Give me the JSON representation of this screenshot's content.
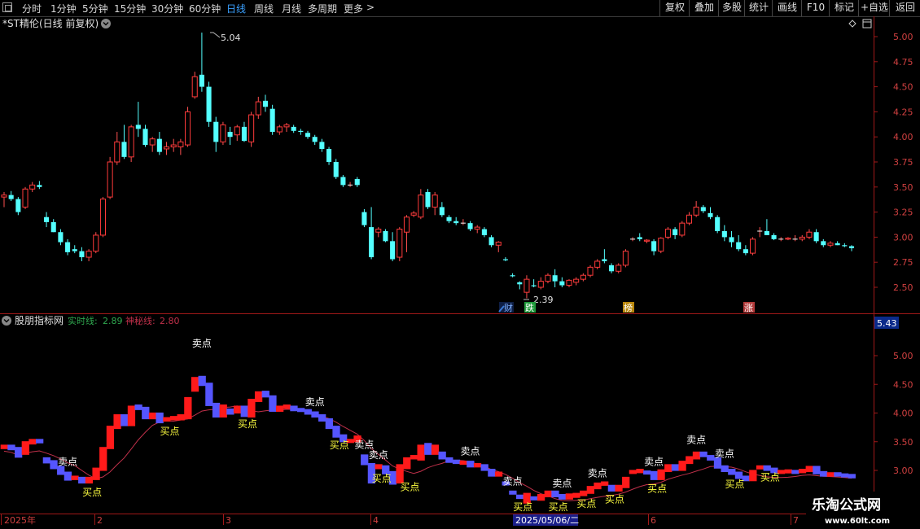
{
  "toolbar": {
    "timeframes": [
      "分时",
      "1分钟",
      "5分钟",
      "15分钟",
      "30分钟",
      "60分钟",
      "日线",
      "周线",
      "月线",
      "多周期",
      "更多"
    ],
    "active": "日线",
    "more_arrow": ">",
    "right_buttons": [
      "复权",
      "叠加",
      "多股",
      "统计",
      "画线",
      "F10",
      "标记",
      "+自选",
      "返回"
    ]
  },
  "main_panel": {
    "title": "*ST精伦(日线 前复权)",
    "y_ticks": [
      "5.00",
      "4.75",
      "4.50",
      "4.25",
      "4.00",
      "3.75",
      "3.50",
      "3.25",
      "3.00",
      "2.75",
      "2.50"
    ],
    "max_label": "5.04",
    "min_label": "2.39",
    "badges": [
      {
        "text": "财",
        "color": "#3b7bd8"
      },
      {
        "text": "跌",
        "color": "#1f9a3a"
      },
      {
        "text": "榜",
        "color": "#b8860b"
      },
      {
        "text": "涨",
        "color": "#b23a3a"
      }
    ]
  },
  "indicator_panel": {
    "name": "股朋指标网",
    "line1_label": "实时线:",
    "line1_value": "2.89",
    "line2_label": "神秘线:",
    "line2_value": "2.80",
    "top_value": "5.43",
    "y_ticks": [
      "5.00",
      "4.50",
      "4.00",
      "3.50",
      "3.00"
    ],
    "sell_label": "卖点",
    "buy_label": "买点"
  },
  "time_axis": {
    "labels": [
      "2025年",
      "2",
      "3",
      "4",
      "5",
      "6",
      "7"
    ],
    "cursor_date": "2025/05/06/二"
  },
  "watermark": {
    "title": "乐淘公式网",
    "url": "www.60lt.com"
  },
  "chart_data": {
    "type": "candlestick",
    "title": "*ST精伦(日线 前复权)",
    "ylim": [
      2.35,
      5.1
    ],
    "colors": {
      "up": "#ff3a3a",
      "down": "#54ffff"
    },
    "candles": [
      [
        3.4,
        3.45,
        3.3,
        3.42
      ],
      [
        3.42,
        3.46,
        3.36,
        3.38
      ],
      [
        3.38,
        3.4,
        3.22,
        3.25
      ],
      [
        3.3,
        3.5,
        3.28,
        3.48
      ],
      [
        3.48,
        3.55,
        3.45,
        3.52
      ],
      [
        3.52,
        3.56,
        3.48,
        3.5
      ],
      [
        3.2,
        3.25,
        3.1,
        3.15
      ],
      [
        3.15,
        3.18,
        3.05,
        3.05
      ],
      [
        3.05,
        3.08,
        2.92,
        2.95
      ],
      [
        2.95,
        2.98,
        2.82,
        2.85
      ],
      [
        2.88,
        2.92,
        2.84,
        2.86
      ],
      [
        2.86,
        2.9,
        2.76,
        2.8
      ],
      [
        2.8,
        2.88,
        2.76,
        2.86
      ],
      [
        2.86,
        3.05,
        2.84,
        3.02
      ],
      [
        3.02,
        3.4,
        3.0,
        3.38
      ],
      [
        3.4,
        3.8,
        3.38,
        3.75
      ],
      [
        3.75,
        4.05,
        3.72,
        3.95
      ],
      [
        3.95,
        4.12,
        3.78,
        3.8
      ],
      [
        3.8,
        4.12,
        3.75,
        4.1
      ],
      [
        4.12,
        4.35,
        4.0,
        4.08
      ],
      [
        4.08,
        4.12,
        3.9,
        3.92
      ],
      [
        3.92,
        4.0,
        3.85,
        3.98
      ],
      [
        3.98,
        4.05,
        3.82,
        3.85
      ],
      [
        3.88,
        3.95,
        3.82,
        3.9
      ],
      [
        3.9,
        3.98,
        3.85,
        3.92
      ],
      [
        3.9,
        3.98,
        3.82,
        3.95
      ],
      [
        3.92,
        4.3,
        3.9,
        4.25
      ],
      [
        4.4,
        4.65,
        4.38,
        4.6
      ],
      [
        4.62,
        5.04,
        4.45,
        4.5
      ],
      [
        4.5,
        4.55,
        4.1,
        4.15
      ],
      [
        4.15,
        4.2,
        3.85,
        3.95
      ],
      [
        3.95,
        4.15,
        3.92,
        4.12
      ],
      [
        4.05,
        4.1,
        3.92,
        4.0
      ],
      [
        4.02,
        4.12,
        3.96,
        4.1
      ],
      [
        4.1,
        4.15,
        3.95,
        3.96
      ],
      [
        3.95,
        4.25,
        3.9,
        4.22
      ],
      [
        4.22,
        4.4,
        4.18,
        4.35
      ],
      [
        4.36,
        4.42,
        4.25,
        4.3
      ],
      [
        4.28,
        4.32,
        4.02,
        4.05
      ],
      [
        4.05,
        4.12,
        4.02,
        4.1
      ],
      [
        4.1,
        4.14,
        4.05,
        4.12
      ],
      [
        4.1,
        4.12,
        4.04,
        4.06
      ],
      [
        4.06,
        4.08,
        4.02,
        4.05
      ],
      [
        4.04,
        4.06,
        3.98,
        4.0
      ],
      [
        4.0,
        4.02,
        3.92,
        3.95
      ],
      [
        3.95,
        3.98,
        3.85,
        3.88
      ],
      [
        3.88,
        3.9,
        3.72,
        3.75
      ],
      [
        3.75,
        3.78,
        3.58,
        3.6
      ],
      [
        3.6,
        3.62,
        3.5,
        3.52
      ],
      [
        3.52,
        3.55,
        3.5,
        3.52
      ],
      [
        3.58,
        3.6,
        3.5,
        3.52
      ],
      [
        3.25,
        3.28,
        3.1,
        3.12
      ],
      [
        3.1,
        3.3,
        2.78,
        2.8
      ],
      [
        3.05,
        3.1,
        3.0,
        3.08
      ],
      [
        3.06,
        3.08,
        2.95,
        2.96
      ],
      [
        2.96,
        3.05,
        2.76,
        2.78
      ],
      [
        2.8,
        3.1,
        2.76,
        3.08
      ],
      [
        3.05,
        3.22,
        2.85,
        3.2
      ],
      [
        3.22,
        3.26,
        3.2,
        3.24
      ],
      [
        3.2,
        3.48,
        3.18,
        3.42
      ],
      [
        3.45,
        3.48,
        3.28,
        3.3
      ],
      [
        3.3,
        3.45,
        3.22,
        3.42
      ],
      [
        3.3,
        3.35,
        3.2,
        3.22
      ],
      [
        3.2,
        3.22,
        3.14,
        3.16
      ],
      [
        3.16,
        3.2,
        3.12,
        3.14
      ],
      [
        3.14,
        3.18,
        3.12,
        3.14
      ],
      [
        3.14,
        3.16,
        3.06,
        3.08
      ],
      [
        3.08,
        3.12,
        3.04,
        3.1
      ],
      [
        3.08,
        3.1,
        3.0,
        3.02
      ],
      [
        3.0,
        3.02,
        2.9,
        2.92
      ],
      [
        2.92,
        2.96,
        2.85,
        2.95
      ],
      [
        2.78,
        2.8,
        2.76,
        2.77
      ],
      [
        2.62,
        2.64,
        2.6,
        2.61
      ],
      [
        2.55,
        2.56,
        2.48,
        2.53
      ],
      [
        2.45,
        2.62,
        2.39,
        2.58
      ],
      [
        2.52,
        2.58,
        2.5,
        2.51
      ],
      [
        2.5,
        2.6,
        2.48,
        2.56
      ],
      [
        2.56,
        2.64,
        2.54,
        2.62
      ],
      [
        2.62,
        2.68,
        2.5,
        2.56
      ],
      [
        2.56,
        2.6,
        2.5,
        2.52
      ],
      [
        2.52,
        2.58,
        2.5,
        2.57
      ],
      [
        2.55,
        2.6,
        2.52,
        2.58
      ],
      [
        2.58,
        2.64,
        2.56,
        2.62
      ],
      [
        2.62,
        2.72,
        2.6,
        2.7
      ],
      [
        2.7,
        2.78,
        2.68,
        2.76
      ],
      [
        2.78,
        2.88,
        2.74,
        2.76
      ],
      [
        2.72,
        2.74,
        2.64,
        2.66
      ],
      [
        2.66,
        2.74,
        2.64,
        2.72
      ],
      [
        2.72,
        2.88,
        2.7,
        2.86
      ],
      [
        2.98,
        3.0,
        2.96,
        2.98
      ],
      [
        3.0,
        3.04,
        2.96,
        2.98
      ],
      [
        2.96,
        2.98,
        2.94,
        2.97
      ],
      [
        2.96,
        2.98,
        2.82,
        2.86
      ],
      [
        2.86,
        3.0,
        2.84,
        2.99
      ],
      [
        3.0,
        3.1,
        2.98,
        3.08
      ],
      [
        3.08,
        3.1,
        2.98,
        3.02
      ],
      [
        3.02,
        3.16,
        3.0,
        3.14
      ],
      [
        3.14,
        3.25,
        3.12,
        3.22
      ],
      [
        3.22,
        3.36,
        3.2,
        3.3
      ],
      [
        3.3,
        3.32,
        3.24,
        3.26
      ],
      [
        3.24,
        3.3,
        3.18,
        3.2
      ],
      [
        3.2,
        3.22,
        3.04,
        3.06
      ],
      [
        3.06,
        3.12,
        2.96,
        3.0
      ],
      [
        3.0,
        3.06,
        2.9,
        2.95
      ],
      [
        2.95,
        3.02,
        2.86,
        2.88
      ],
      [
        2.88,
        2.92,
        2.82,
        2.84
      ],
      [
        2.84,
        3.0,
        2.82,
        2.98
      ],
      [
        3.06,
        3.1,
        3.0,
        3.06
      ],
      [
        3.06,
        3.18,
        3.02,
        3.02
      ],
      [
        3.02,
        3.04,
        2.97,
        2.98
      ],
      [
        2.98,
        3.0,
        2.96,
        2.98
      ],
      [
        2.98,
        3.0,
        2.97,
        2.99
      ],
      [
        2.98,
        3.02,
        2.96,
        2.98
      ],
      [
        2.98,
        3.02,
        2.96,
        3.0
      ],
      [
        3.0,
        3.08,
        2.98,
        3.05
      ],
      [
        3.05,
        3.08,
        2.94,
        2.96
      ],
      [
        2.96,
        2.98,
        2.9,
        2.92
      ],
      [
        2.92,
        2.96,
        2.9,
        2.94
      ],
      [
        2.94,
        2.96,
        2.92,
        2.92
      ],
      [
        2.92,
        2.94,
        2.9,
        2.91
      ],
      [
        2.91,
        2.92,
        2.86,
        2.89
      ]
    ],
    "indicator": {
      "name": "股朋指标网",
      "ylim": [
        2.6,
        5.43
      ],
      "series": [
        {
          "name": "实时线",
          "color": "#2fa84f",
          "last": 2.89
        },
        {
          "name": "神秘线",
          "color": "#c0304a",
          "last": 2.8
        }
      ],
      "sell_points": [
        9,
        28,
        44,
        51,
        53,
        66,
        72,
        79,
        84,
        92,
        98,
        102
      ],
      "buy_points": [
        12,
        23,
        34,
        47,
        53,
        57,
        73,
        78,
        82,
        86,
        92,
        103,
        108
      ]
    }
  }
}
